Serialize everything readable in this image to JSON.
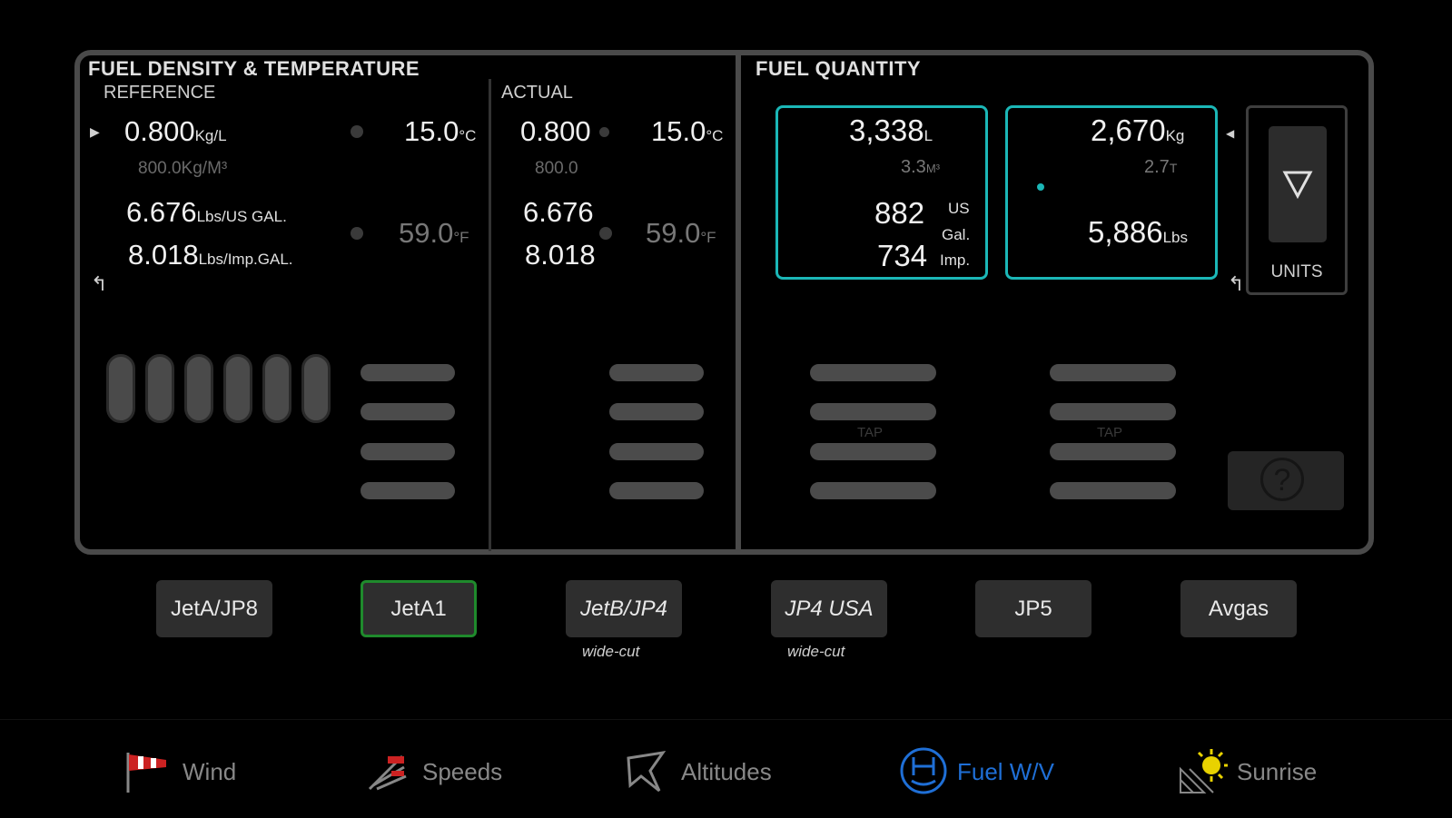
{
  "colors": {
    "accent_cyan": "#1bb7b7",
    "selected_green": "#1f8a2c",
    "active_tab_blue": "#1f6fd6"
  },
  "density": {
    "title": "FUEL DENSITY & TEMPERATURE",
    "reference": {
      "label": "REFERENCE",
      "kgl": "0.800",
      "kgl_unit": "Kg/L",
      "kgm3": "800.0Kg/M³",
      "lbs_usgal": "6.676",
      "lbs_usgal_unit": "Lbs/US GAL.",
      "lbs_impgal": "8.018",
      "lbs_impgal_unit": "Lbs/Imp.GAL.",
      "temp_c": "15.0",
      "temp_c_unit": "°C",
      "temp_f": "59.0",
      "temp_f_unit": "°F"
    },
    "actual": {
      "label": "ACTUAL",
      "kgl": "0.800",
      "kgm3": "800.0",
      "lbs_usgal": "6.676",
      "lbs_impgal": "8.018",
      "temp_c": "15.0",
      "temp_c_unit": "°C",
      "temp_f": "59.0",
      "temp_f_unit": "°F"
    }
  },
  "quantity": {
    "title": "FUEL QUANTITY",
    "volume": {
      "liters": "3,338",
      "liters_unit": "L",
      "m3": "3.3",
      "m3_unit": "M³",
      "us_gal": "882",
      "us_unit": "US",
      "gal_unit": "Gal.",
      "imp_gal": "734",
      "imp_unit": "Imp."
    },
    "mass": {
      "kg": "2,670",
      "kg_unit": "Kg",
      "tonnes": "2.7",
      "tonnes_unit": "T",
      "lbs": "5,886",
      "lbs_unit": "Lbs"
    },
    "units_label": "UNITS",
    "units_icon": "triangle-down-icon",
    "tap_label": "TAP",
    "help_icon": "question-icon",
    "help_glyph": "?"
  },
  "fuel_types": [
    {
      "label": "JetA/JP8",
      "sub": ""
    },
    {
      "label": "JetA1",
      "sub": ""
    },
    {
      "label": "JetB/JP4",
      "sub": "wide-cut"
    },
    {
      "label": "JP4 USA",
      "sub": "wide-cut"
    },
    {
      "label": "JP5",
      "sub": ""
    },
    {
      "label": "Avgas",
      "sub": ""
    }
  ],
  "selected_fuel": "JetA1",
  "tabs": [
    {
      "label": "Wind",
      "icon": "windsock-icon"
    },
    {
      "label": "Speeds",
      "icon": "speeds-icon"
    },
    {
      "label": "Altitudes",
      "icon": "altitudes-icon"
    },
    {
      "label": "Fuel W/V",
      "icon": "fuel-icon"
    },
    {
      "label": "Sunrise",
      "icon": "sunrise-icon"
    }
  ],
  "active_tab": "Fuel W/V"
}
